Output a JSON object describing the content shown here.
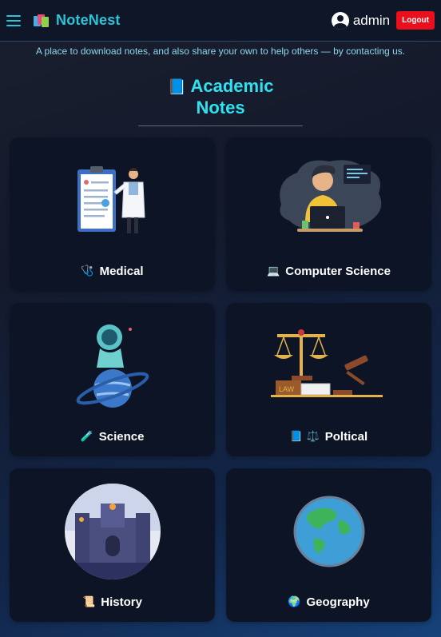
{
  "header": {
    "menu_icon": "hamburger-icon",
    "brand_icon": "books-logo-icon",
    "brand_title": "NoteNest",
    "user_icon": "user-circle-icon",
    "username": "admin",
    "logout_label": "Logout"
  },
  "tagline": "A place to download notes, and also share your own to help others — by contacting us.",
  "section": {
    "icon": "📘",
    "title_line1": "Academic",
    "title_line2": "Notes"
  },
  "categories": [
    {
      "icon": "🩺",
      "label": "Medical",
      "art": "doctor-clipboard-illustration"
    },
    {
      "icon": "💻",
      "label": "Computer Science",
      "art": "developer-laptop-illustration"
    },
    {
      "icon": "🧪",
      "label": "Science",
      "art": "astronaut-planet-illustration"
    },
    {
      "icon": "📘 ⚖️",
      "label": "Poltical",
      "art": "law-scale-gavel-illustration"
    },
    {
      "icon": "📜",
      "label": "History",
      "art": "castle-illustration"
    },
    {
      "icon": "🌍",
      "label": "Geography",
      "art": "globe-illustration"
    }
  ],
  "colors": {
    "accent": "#2ec4d8",
    "title": "#2ee2f2",
    "logout": "#e8101c",
    "card_bg": "#0c1426"
  }
}
